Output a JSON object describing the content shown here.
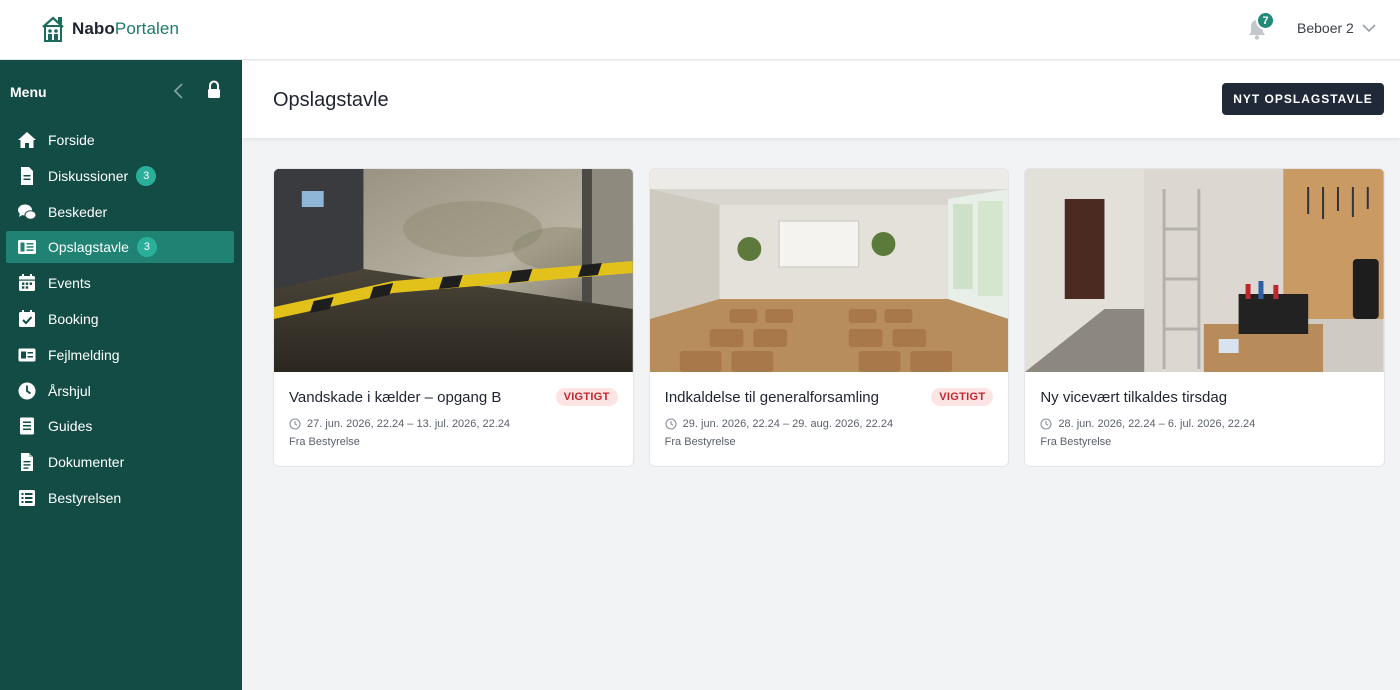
{
  "header": {
    "logo_bold": "Nabo",
    "logo_light": "Portalen",
    "notification_count": "7",
    "user_name": "Beboer 2"
  },
  "sidebar": {
    "title": "Menu",
    "items": [
      {
        "label": "Forside",
        "icon": "home-icon"
      },
      {
        "label": "Diskussioner",
        "icon": "document-icon",
        "badge": "3"
      },
      {
        "label": "Beskeder",
        "icon": "chat-icon"
      },
      {
        "label": "Opslagstavle",
        "icon": "board-icon",
        "badge": "3",
        "active": true
      },
      {
        "label": "Events",
        "icon": "calendar-icon"
      },
      {
        "label": "Booking",
        "icon": "calendar-check-icon"
      },
      {
        "label": "Fejlmelding",
        "icon": "report-icon"
      },
      {
        "label": "Årshjul",
        "icon": "clock-icon"
      },
      {
        "label": "Guides",
        "icon": "guide-icon"
      },
      {
        "label": "Dokumenter",
        "icon": "file-icon"
      },
      {
        "label": "Bestyrelsen",
        "icon": "list-icon"
      }
    ]
  },
  "main": {
    "page_title": "Opslagstavle",
    "new_button": "NYT OPSLAGSTAVLE",
    "cards": [
      {
        "title": "Vandskade i kælder – opgang B",
        "tag": "VIGTIGT",
        "date": "27. jun. 2026, 22.24 – 13. jul. 2026, 22.24",
        "from": "Fra Bestyrelse"
      },
      {
        "title": "Indkaldelse til generalforsamling",
        "tag": "VIGTIGT",
        "date": "29. jun. 2026, 22.24 – 29. aug. 2026, 22.24",
        "from": "Fra Bestyrelse"
      },
      {
        "title": "Ny vicevært tilkaldes tirsdag",
        "tag": "",
        "date": "28. jun. 2026, 22.24 – 6. jul. 2026, 22.24",
        "from": "Fra Bestyrelse"
      }
    ]
  },
  "colors": {
    "sidebar_bg": "#124c44",
    "sidebar_active": "#1f8272",
    "badge": "#2ab09a",
    "primary_button": "#1f2937",
    "tag_bg": "#fde4e4",
    "tag_text": "#c0262d"
  }
}
